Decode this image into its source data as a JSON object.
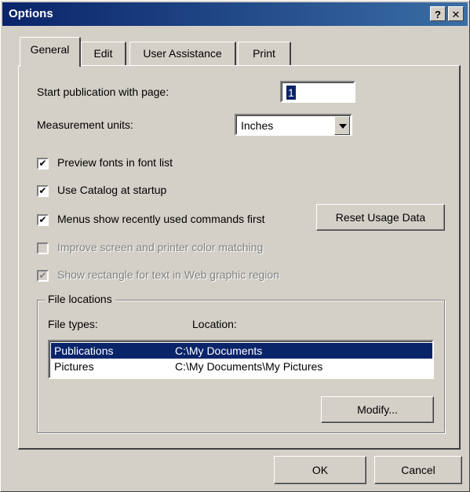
{
  "window": {
    "title": "Options",
    "help_label": "?",
    "close_label": "✕"
  },
  "tabs": [
    {
      "label": "General",
      "active": true
    },
    {
      "label": "Edit",
      "active": false
    },
    {
      "label": "User Assistance",
      "active": false
    },
    {
      "label": "Print",
      "active": false
    }
  ],
  "start_page": {
    "label": "Start publication with page:",
    "value": "1"
  },
  "units": {
    "label": "Measurement units:",
    "value": "Inches"
  },
  "checkboxes": [
    {
      "label": "Preview fonts in font list",
      "checked": true,
      "enabled": true
    },
    {
      "label": "Use Catalog at startup",
      "checked": true,
      "enabled": true
    },
    {
      "label": "Menus show recently used commands first",
      "checked": true,
      "enabled": true
    },
    {
      "label": "Improve screen and printer color matching",
      "checked": false,
      "enabled": false
    },
    {
      "label": "Show rectangle for text in Web graphic region",
      "checked": true,
      "enabled": false
    }
  ],
  "reset_button": "Reset Usage Data",
  "file_locations": {
    "title": "File locations",
    "file_types_header": "File types:",
    "location_header": "Location:",
    "rows": [
      {
        "type": "Publications",
        "location": "C:\\My Documents",
        "selected": true
      },
      {
        "type": "Pictures",
        "location": "C:\\My Documents\\My Pictures",
        "selected": false
      }
    ],
    "modify_button": "Modify..."
  },
  "ok_button": "OK",
  "cancel_button": "Cancel"
}
